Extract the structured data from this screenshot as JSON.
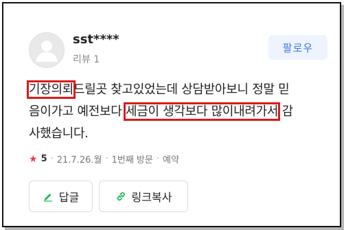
{
  "user": {
    "name": "sst****",
    "review_count": "리뷰 1",
    "follow_label": "팔로우"
  },
  "review": {
    "line1_a": "기장의뢰",
    "line1_b": "드릴곳 찾고있었는데 상담받아보니 정말 믿",
    "line2_a": "음이가고 예전보다 ",
    "line2_b": "세금이 생각보다 많이내려가서",
    "line2_c": " 감",
    "line3": "사했습니다."
  },
  "meta": {
    "rating": "5",
    "date": "21.7.26.월",
    "visit": "1번째 방문",
    "type": "예약",
    "star_color": "#e8384f"
  },
  "actions": {
    "reply_label": "답글",
    "copy_link_label": "링크복사",
    "reply_icon": "pencil-icon",
    "copy_icon": "link-icon",
    "icon_color": "#1fb85a"
  },
  "colors": {
    "highlight": "#e01818",
    "follow_text": "#3c76e6",
    "follow_bg": "#eef4ff"
  }
}
